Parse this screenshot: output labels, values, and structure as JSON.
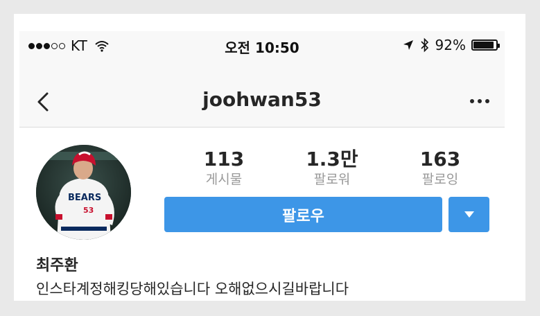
{
  "status_bar": {
    "carrier": "KT",
    "time": "오전 10:50",
    "battery": "92%",
    "battery_level": 0.92,
    "signal_bars": 3,
    "signal_total": 5
  },
  "nav": {
    "username": "joohwan53"
  },
  "profile": {
    "stats": [
      {
        "value": "113",
        "label": "게시물"
      },
      {
        "value": "1.3만",
        "label": "팔로워"
      },
      {
        "value": "163",
        "label": "팔로잉"
      }
    ],
    "follow_label": "팔로우",
    "name": "최주환",
    "bio": "인스타계정해킹당해있습니다 오해없으시길바랍니다",
    "avatar_jersey_text": "BEARS",
    "avatar_jersey_number": "53"
  },
  "colors": {
    "accent": "#3d96e7",
    "text": "#262626",
    "muted": "#999999",
    "bar_bg": "#f8f8f8"
  }
}
